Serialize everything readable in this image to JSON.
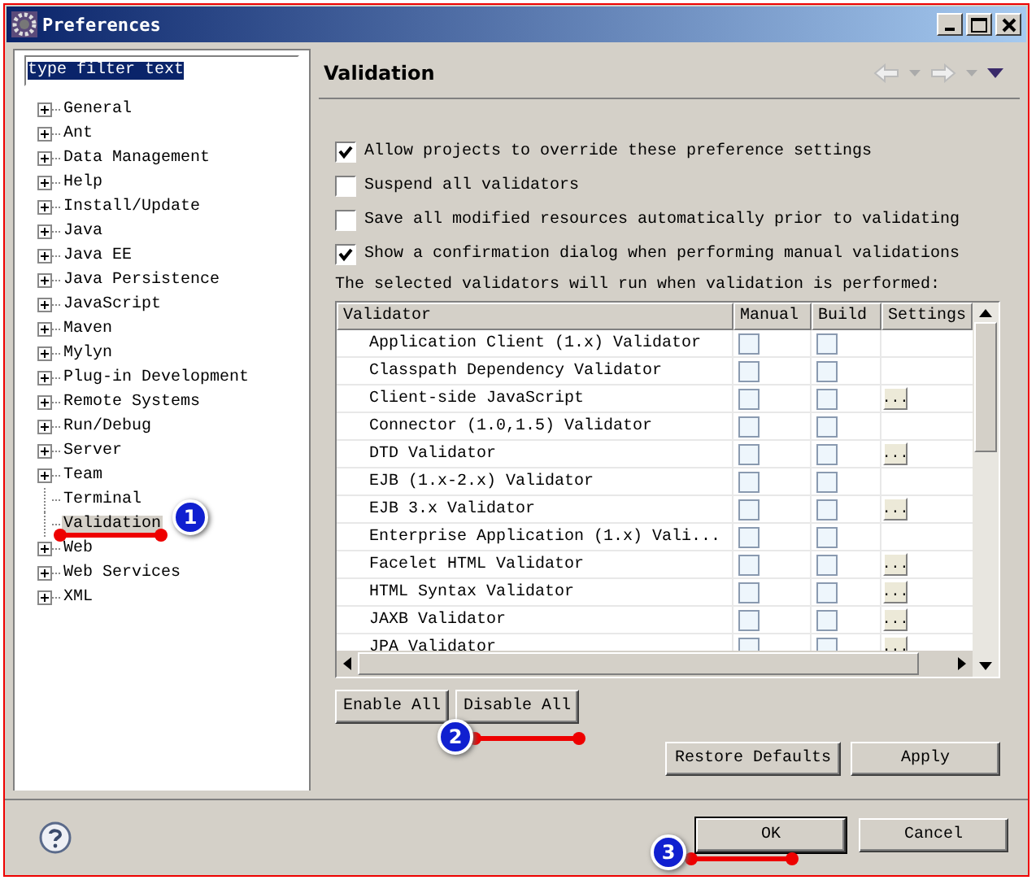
{
  "window": {
    "title": "Preferences"
  },
  "filter": {
    "value": "type filter text",
    "text_selected": true
  },
  "tree": [
    {
      "label": "General",
      "expandable": true,
      "selected": false
    },
    {
      "label": "Ant",
      "expandable": true,
      "selected": false
    },
    {
      "label": "Data Management",
      "expandable": true,
      "selected": false
    },
    {
      "label": "Help",
      "expandable": true,
      "selected": false
    },
    {
      "label": "Install/Update",
      "expandable": true,
      "selected": false
    },
    {
      "label": "Java",
      "expandable": true,
      "selected": false
    },
    {
      "label": "Java EE",
      "expandable": true,
      "selected": false
    },
    {
      "label": "Java Persistence",
      "expandable": true,
      "selected": false
    },
    {
      "label": "JavaScript",
      "expandable": true,
      "selected": false
    },
    {
      "label": "Maven",
      "expandable": true,
      "selected": false
    },
    {
      "label": "Mylyn",
      "expandable": true,
      "selected": false
    },
    {
      "label": "Plug-in Development",
      "expandable": true,
      "selected": false
    },
    {
      "label": "Remote Systems",
      "expandable": true,
      "selected": false
    },
    {
      "label": "Run/Debug",
      "expandable": true,
      "selected": false
    },
    {
      "label": "Server",
      "expandable": true,
      "selected": false
    },
    {
      "label": "Team",
      "expandable": true,
      "selected": false
    },
    {
      "label": "Terminal",
      "expandable": false,
      "selected": false
    },
    {
      "label": "Validation",
      "expandable": false,
      "selected": true
    },
    {
      "label": "Web",
      "expandable": true,
      "selected": false
    },
    {
      "label": "Web Services",
      "expandable": true,
      "selected": false
    },
    {
      "label": "XML",
      "expandable": true,
      "selected": false
    }
  ],
  "page": {
    "title": "Validation",
    "options": [
      {
        "label": "Allow projects to override these preference settings",
        "checked": true
      },
      {
        "label": "Suspend all validators",
        "checked": false
      },
      {
        "label": "Save all modified resources automatically prior to validating",
        "checked": false
      },
      {
        "label": "Show a confirmation dialog when performing manual validations",
        "checked": true
      }
    ],
    "table_caption": "The selected validators will run when validation is performed:",
    "columns": [
      "Validator",
      "Manual",
      "Build",
      "Settings"
    ],
    "rows": [
      {
        "validator": "Application Client (1.x) Validator",
        "manual": false,
        "build": false
      },
      {
        "validator": "Classpath Dependency Validator",
        "manual": false,
        "build": false
      },
      {
        "validator": "Client-side JavaScript",
        "manual": false,
        "build": false,
        "settings": "..."
      },
      {
        "validator": "Connector (1.0,1.5) Validator",
        "manual": false,
        "build": false
      },
      {
        "validator": "DTD Validator",
        "manual": false,
        "build": false,
        "settings": "..."
      },
      {
        "validator": "EJB (1.x-2.x) Validator",
        "manual": false,
        "build": false
      },
      {
        "validator": "EJB 3.x Validator",
        "manual": false,
        "build": false,
        "settings": "..."
      },
      {
        "validator": "Enterprise Application (1.x) Vali...",
        "manual": false,
        "build": false
      },
      {
        "validator": "Facelet HTML Validator",
        "manual": false,
        "build": false,
        "settings": "..."
      },
      {
        "validator": "HTML Syntax Validator",
        "manual": false,
        "build": false,
        "settings": "..."
      },
      {
        "validator": "JAXB Validator",
        "manual": false,
        "build": false,
        "settings": "..."
      },
      {
        "validator": "JPA Validator",
        "manual": false,
        "build": false,
        "settings": "..."
      }
    ],
    "table_buttons": [
      "Enable All",
      "Disable All"
    ],
    "page_buttons": [
      "Restore Defaults",
      "Apply"
    ]
  },
  "footer_buttons": [
    {
      "label": "OK",
      "default": true
    },
    {
      "label": "Cancel",
      "default": false
    }
  ],
  "annotations": [
    {
      "label": "1"
    },
    {
      "label": "2"
    },
    {
      "label": "3"
    }
  ]
}
